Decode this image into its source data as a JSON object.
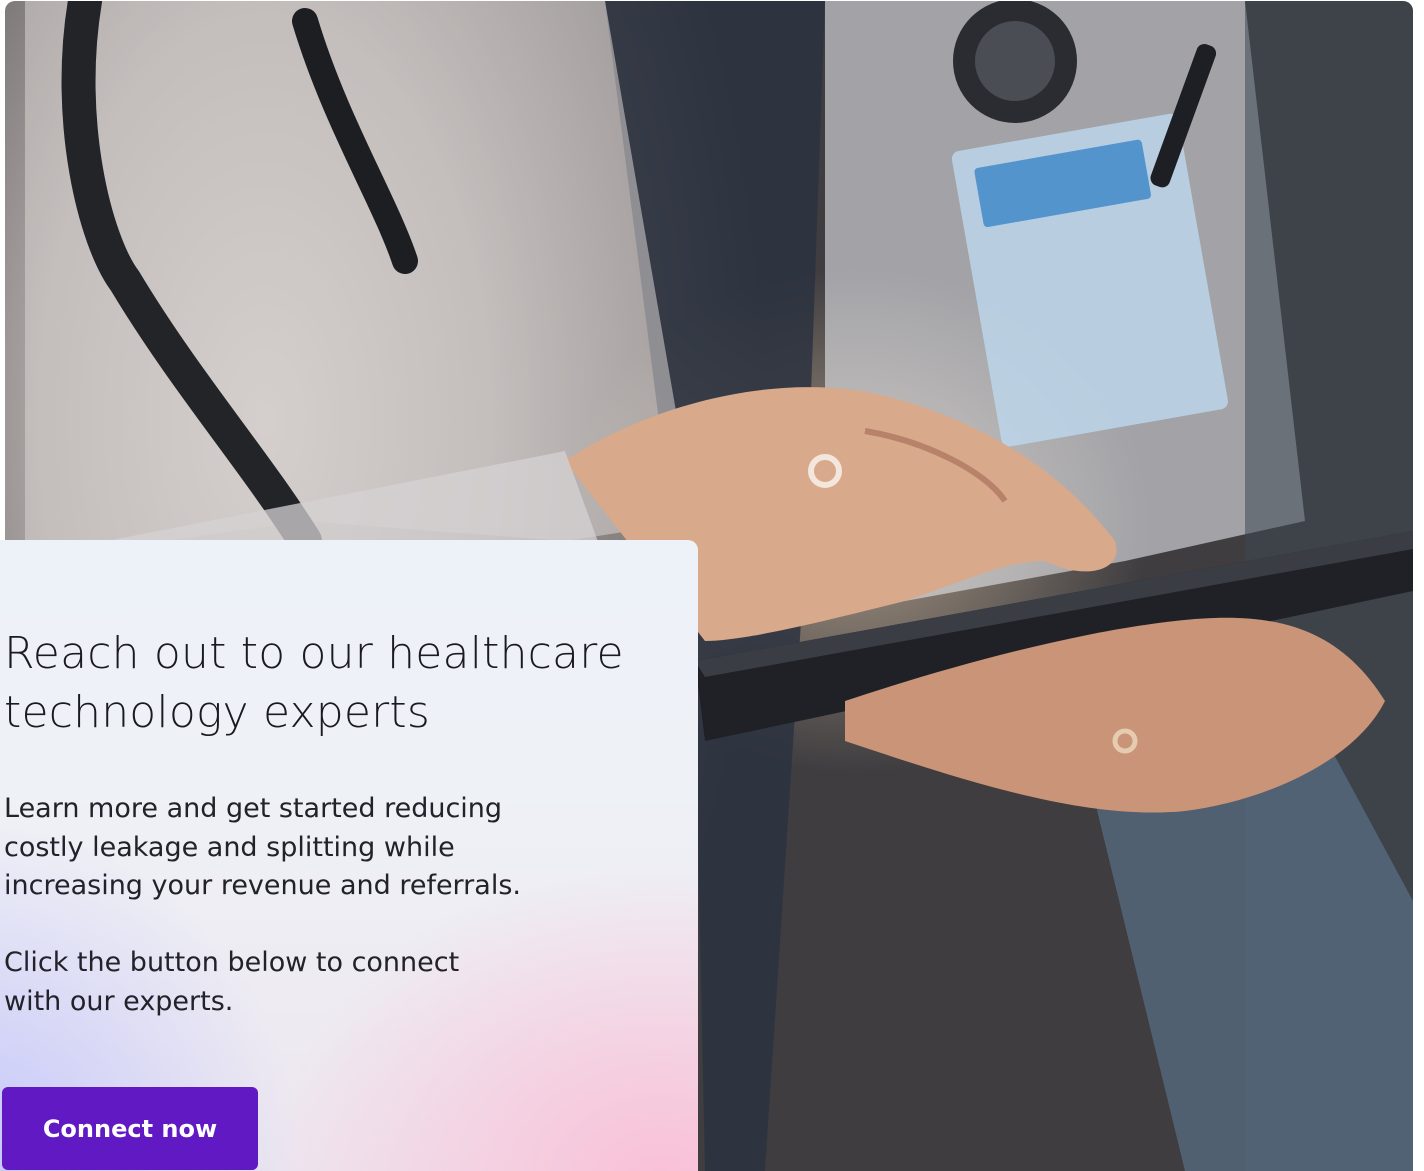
{
  "photo": {
    "description_icon": "doctor-tablet-photo"
  },
  "card": {
    "title": "Reach out to our healthcare technology experts",
    "body_1": "Learn more and get started reducing costly leakage and splitting while increasing your revenue and referrals.",
    "body_2": "Click the button below to connect with our experts.",
    "button_label": "Connect now"
  },
  "colors": {
    "button_bg": "#6119c4",
    "button_text": "#ffffff",
    "heading_text": "#1a1a22",
    "gradient_pink": "#fabed6",
    "gradient_lavender": "#c0c4fc"
  }
}
